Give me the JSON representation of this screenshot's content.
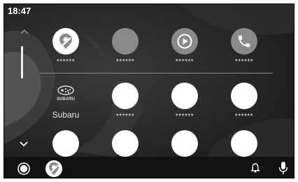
{
  "status_bar": {
    "time": "18:47"
  },
  "apps_row1": [
    {
      "label": "******",
      "icon": "maps-icon"
    },
    {
      "label": "******",
      "icon": "blank-app-icon"
    },
    {
      "label": "******",
      "icon": "play-icon"
    },
    {
      "label": "******",
      "icon": "phone-icon"
    }
  ],
  "apps_row2": [
    {
      "label": "Subaru",
      "icon": "subaru-logo-icon",
      "logo_text": "SUBARU"
    },
    {
      "label": "******",
      "icon": "blank-app-icon"
    },
    {
      "label": "******",
      "icon": "blank-app-icon"
    },
    {
      "label": "******",
      "icon": "blank-app-icon"
    }
  ],
  "apps_row3": [
    {
      "icon": "blank-app-icon"
    },
    {
      "icon": "blank-app-icon"
    },
    {
      "icon": "blank-app-icon"
    },
    {
      "icon": "blank-app-icon"
    }
  ],
  "bottom_bar": {
    "home_icon": "home-circle-icon",
    "nav_app_icon": "maps-icon",
    "notification_icon": "bell-icon",
    "voice_icon": "microphone-icon"
  },
  "colors": {
    "background": "#1d1d1f",
    "bottom_bar": "#121212",
    "icon_white": "#ffffff",
    "icon_grey": "#8a8a8a",
    "text": "#e8e8e8"
  }
}
